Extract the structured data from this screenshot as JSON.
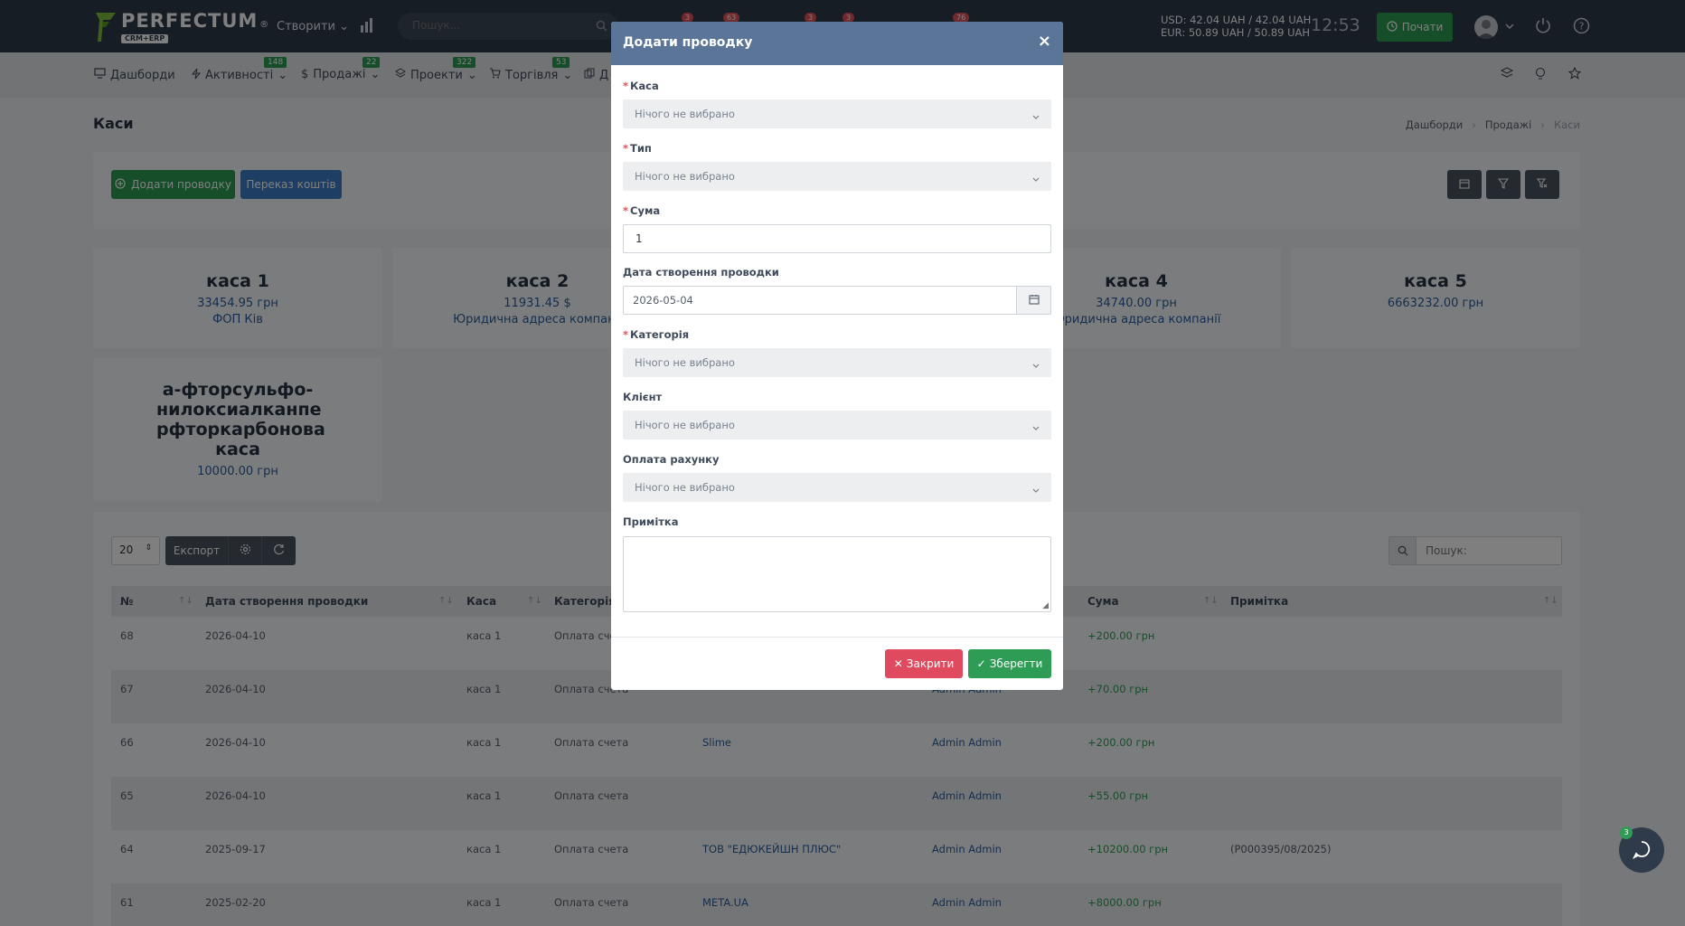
{
  "app": {
    "logo_text": "PERFECTUM",
    "logo_sub": "CRM+ERP",
    "logo_reg": "®",
    "create_label": "Створити",
    "search_placeholder": "Пошук...",
    "notif_badges": [
      "3",
      "63",
      "3",
      "3",
      "76"
    ],
    "currency_usd": "USD: 42.04 UAH / 42.04 UAH",
    "currency_eur": "EUR: 50.89 UAH / 50.89 UAH",
    "time": "12:53",
    "start_label": "Почати"
  },
  "menu": {
    "items": [
      {
        "label": "Дашборди",
        "badge": ""
      },
      {
        "label": "Активності",
        "badge": "148"
      },
      {
        "label": "Продажі",
        "badge": "22"
      },
      {
        "label": "Проекти",
        "badge": "322"
      },
      {
        "label": "Торгівля",
        "badge": "53"
      },
      {
        "label": "Д",
        "badge": ""
      }
    ]
  },
  "page": {
    "title": "Каси",
    "breadcrumb": [
      "Дашборди",
      "Продажі",
      "Каси"
    ],
    "add_button": "Додати проводку",
    "transfer_button": "Переказ коштів"
  },
  "kassas": [
    {
      "name": "каса 1",
      "sum": "33454.95 грн",
      "sub": "ФОП Ків"
    },
    {
      "name": "каса 2",
      "sum": "11931.45 $",
      "sub": "Юридична адреса компанії"
    },
    {
      "name": "каса 4",
      "sum": "34740.00 грн",
      "sub": "Юридична адреса компанії"
    },
    {
      "name": "каса 5",
      "sum": "6663232.00 грн",
      "sub": ""
    },
    {
      "name": "а-фторсульфо-нилоксиалканпе рфторкарбонова каса",
      "sum": "10000.00 грн",
      "sub": ""
    }
  ],
  "table": {
    "page_size": "20",
    "export_label": "Експорт",
    "search_placeholder": "Пошук:",
    "columns": [
      "№",
      "Дата створення проводки",
      "Каса",
      "Категорія",
      "Сума",
      "Примітка"
    ],
    "rows": [
      {
        "id": "68",
        "date": "2026-04-10",
        "kassa": "каса 1",
        "category": "Оплата счета",
        "client": "",
        "user": "",
        "sum": "+200.00 грн",
        "note": ""
      },
      {
        "id": "67",
        "date": "2026-04-10",
        "kassa": "каса 1",
        "category": "Оплата счета",
        "client": "",
        "user": "Admin Admin",
        "sum": "+70.00 грн",
        "note": ""
      },
      {
        "id": "66",
        "date": "2026-04-10",
        "kassa": "каса 1",
        "category": "Оплата счета",
        "client": "Slime",
        "user": "Admin Admin",
        "sum": "+200.00 грн",
        "note": ""
      },
      {
        "id": "65",
        "date": "2026-04-10",
        "kassa": "каса 1",
        "category": "Оплата счета",
        "client": "",
        "user": "Admin Admin",
        "sum": "+55.00 грн",
        "note": ""
      },
      {
        "id": "64",
        "date": "2025-09-17",
        "kassa": "каса 1",
        "category": "Оплата счета",
        "client": "ТОВ \"ЕДЮКЕЙШН ПЛЮС\"",
        "user": "Admin Admin",
        "sum": "+10200.00 грн",
        "note": "(P000395/08/2025)"
      },
      {
        "id": "61",
        "date": "2025-02-20",
        "kassa": "каса 1",
        "category": "Оплата счета",
        "client": "META.UA",
        "user": "Admin Admin",
        "sum": "+8000.00 грн",
        "note": ""
      }
    ]
  },
  "chat_badge": "3",
  "modal": {
    "title": "Додати проводку",
    "close_symbol": "×",
    "fields": {
      "kassa_label": "Каса",
      "type_label": "Тип",
      "sum_label": "Сума",
      "sum_value": "1",
      "date_label": "Дата створення проводки",
      "date_value": "2026-05-04",
      "category_label": "Категорія",
      "client_label": "Клієнт",
      "invoice_label": "Оплата рахунку",
      "note_label": "Примітка",
      "nothing_selected": "Нічого не вибрано"
    },
    "close_button": "Закрити",
    "save_button": "Зберегти"
  }
}
